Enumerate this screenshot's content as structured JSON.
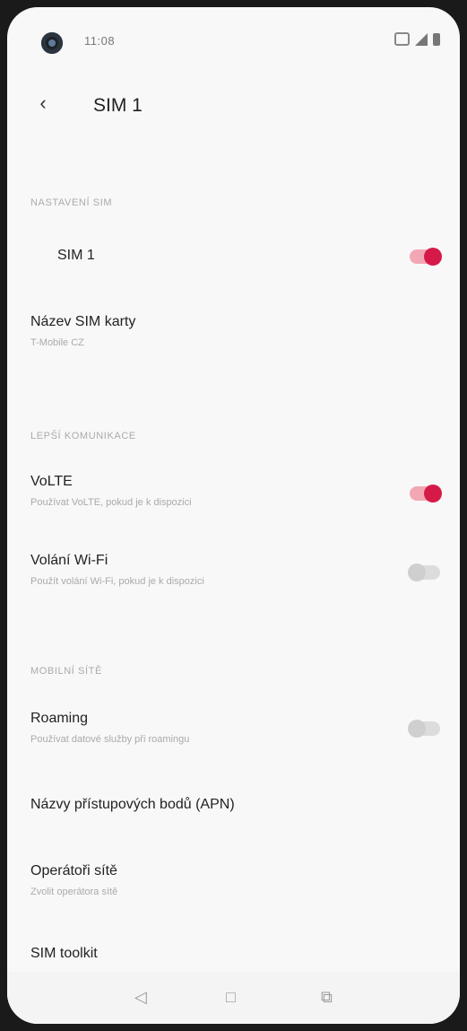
{
  "status_bar": {
    "time": "11:08",
    "icons": [
      "wifi-icon",
      "signal-icon",
      "battery-icon"
    ]
  },
  "header": {
    "back_icon": "‹",
    "title": "SIM 1"
  },
  "sections": {
    "sim_settings": "NASTAVENÍ SIM",
    "call_settings": "LEPŠÍ KOMUNIKACE",
    "mobile_data": "MOBILNÍ SÍTĚ"
  },
  "rows": {
    "sim1": {
      "title": "SIM 1",
      "enabled": true
    },
    "sim_name": {
      "title": "Název SIM karty",
      "subtitle": "T-Mobile CZ"
    },
    "volte": {
      "title": "VoLTE",
      "subtitle": "Používat VoLTE, pokud je k dispozici",
      "enabled": true
    },
    "wifi_calling": {
      "title": "Volání Wi-Fi",
      "subtitle": "Použít volání Wi-Fi, pokud je k dispozici",
      "enabled": false
    },
    "roaming": {
      "title": "Roaming",
      "subtitle": "Používat datové služby při roamingu",
      "enabled": false
    },
    "apn": {
      "title": "Názvy přístupových bodů (APN)"
    },
    "operator": {
      "title": "Operátoři sítě",
      "subtitle": "Zvolit operátora sítě"
    },
    "sim_toolkit": {
      "title": "SIM toolkit"
    }
  },
  "nav_bar": {
    "back": "◁",
    "home": "□",
    "recents": "⧉"
  },
  "colors": {
    "accent": "#d61a48",
    "background": "#f8f8f8"
  }
}
